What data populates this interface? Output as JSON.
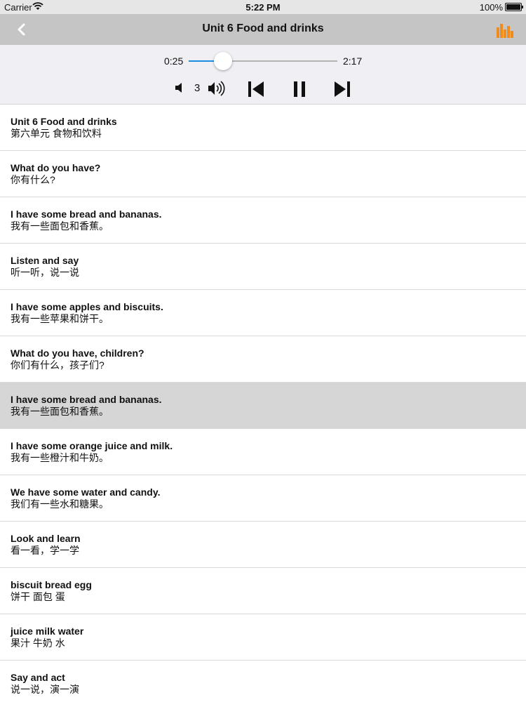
{
  "status": {
    "carrier": "Carrier",
    "time": "5:22 PM",
    "battery": "100%"
  },
  "nav": {
    "title": "Unit 6  Food and drinks",
    "back_icon": "chevron-left-icon",
    "right_icon": "equalizer-icon",
    "accent": "#f08c1e"
  },
  "player": {
    "current_time": "0:25",
    "duration": "2:17",
    "progress": 0.23,
    "volume_level": "3",
    "fill_color": "#1a8ee0"
  },
  "lines": [
    {
      "en": "Unit 6 Food and drinks",
      "zh": "第六单元 食物和饮料"
    },
    {
      "en": "What do you have?",
      "zh": "你有什么?"
    },
    {
      "en": "I have some bread and bananas.",
      "zh": "我有一些面包和香蕉。"
    },
    {
      "en": "Listen and say",
      "zh": "听一听，说一说"
    },
    {
      "en": "I have some apples and biscuits.",
      "zh": "我有一些苹果和饼干。"
    },
    {
      "en": "What do you have, children?",
      "zh": "你们有什么，孩子们?"
    },
    {
      "en": "I have some bread and bananas.",
      "zh": "我有一些面包和香蕉。",
      "selected": true
    },
    {
      "en": "I have some orange juice and milk.",
      "zh": "我有一些橙汁和牛奶。"
    },
    {
      "en": "We have some water and candy.",
      "zh": "我们有一些水和糖果。"
    },
    {
      "en": "Look and learn",
      "zh": "看一看，学一学"
    },
    {
      "en": "biscuit bread egg",
      "zh": "饼干 面包 蛋"
    },
    {
      "en": "juice milk water",
      "zh": "果汁 牛奶 水"
    },
    {
      "en": "Say and act",
      "zh": "说一说，演一演"
    }
  ]
}
